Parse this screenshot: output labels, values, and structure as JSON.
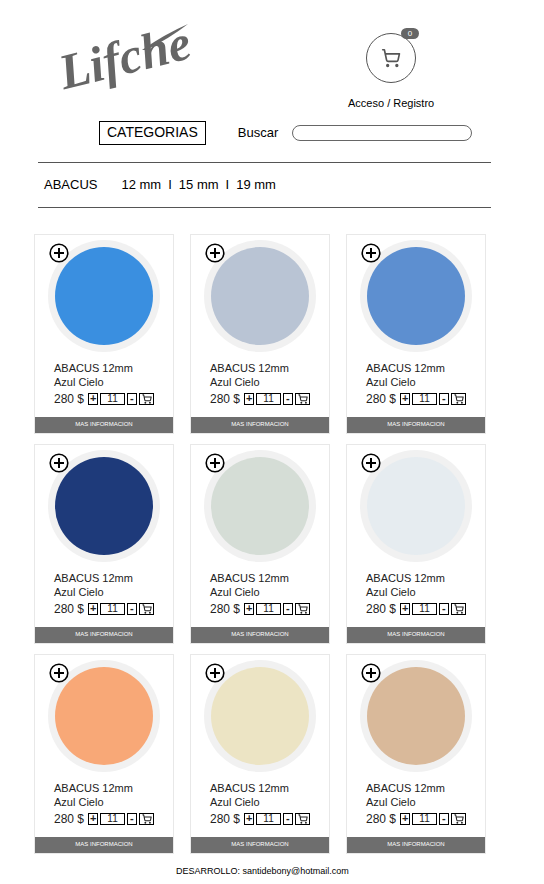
{
  "header": {
    "logo": "Lifche",
    "cart_count": "0",
    "login": "Acceso / Registro",
    "categories": "CATEGORIAS",
    "search": {
      "label": "Buscar",
      "placeholder": ""
    }
  },
  "breadcrumb": {
    "title": "ABACUS",
    "separator": "I",
    "sizes": [
      "12 mm",
      "15 mm",
      "19 mm"
    ]
  },
  "controls": {
    "plus": "+",
    "minus": "-",
    "more": "MAS INFORMACION"
  },
  "products": [
    {
      "name": "ABACUS 12mm",
      "color_name": "Azul Cielo",
      "price": "280 $",
      "qty": "11",
      "color": "#3a8fe0"
    },
    {
      "name": "ABACUS 12mm",
      "color_name": "Azul Cielo",
      "price": "280 $",
      "qty": "11",
      "color": "#b9c4d4"
    },
    {
      "name": "ABACUS 12mm",
      "color_name": "Azul Cielo",
      "price": "280 $",
      "qty": "11",
      "color": "#5d8fd0"
    },
    {
      "name": "ABACUS 12mm",
      "color_name": "Azul Cielo",
      "price": "280 $",
      "qty": "11",
      "color": "#1e3a7a"
    },
    {
      "name": "ABACUS 12mm",
      "color_name": "Azul Cielo",
      "price": "280 $",
      "qty": "11",
      "color": "#d5ddd6"
    },
    {
      "name": "ABACUS 12mm",
      "color_name": "Azul Cielo",
      "price": "280 $",
      "qty": "11",
      "color": "#e6ecf0"
    },
    {
      "name": "ABACUS 12mm",
      "color_name": "Azul Cielo",
      "price": "280 $",
      "qty": "11",
      "color": "#f8a877"
    },
    {
      "name": "ABACUS 12mm",
      "color_name": "Azul Cielo",
      "price": "280 $",
      "qty": "11",
      "color": "#ece4c4"
    },
    {
      "name": "ABACUS 12mm",
      "color_name": "Azul Cielo",
      "price": "280 $",
      "qty": "11",
      "color": "#d9b99a"
    }
  ],
  "footer": "DESARROLLO: santidebony@hotmail.com"
}
